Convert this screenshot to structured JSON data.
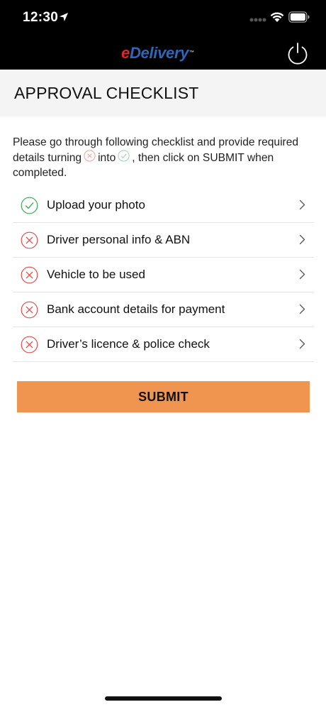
{
  "status_bar": {
    "time": "12:30",
    "icons": [
      "location-arrow-icon",
      "cellular-signal-icon",
      "wifi-icon",
      "battery-icon"
    ]
  },
  "header": {
    "logo_prefix": "e",
    "logo_text": "Delivery",
    "logo_tm": "™",
    "power_icon": "power-icon"
  },
  "page": {
    "title": "APPROVAL CHECKLIST"
  },
  "instructions": {
    "part1": "Please go through following checklist and provide required details turning",
    "part2": "into",
    "part3": ", then click on SUBMIT when completed."
  },
  "checklist": {
    "items": [
      {
        "label": "Upload your photo",
        "status": "complete"
      },
      {
        "label": "Driver personal info & ABN",
        "status": "incomplete"
      },
      {
        "label": "Vehicle to be used",
        "status": "incomplete"
      },
      {
        "label": "Bank account details for payment",
        "status": "incomplete"
      },
      {
        "label": "Driver’s licence & police check",
        "status": "incomplete"
      }
    ]
  },
  "actions": {
    "submit_label": "SUBMIT"
  },
  "colors": {
    "header_bg": "#000000",
    "title_band_bg": "#f5f4f5",
    "complete_green": "#3aa655",
    "incomplete_red": "#e04a4a",
    "submit_orange": "#f0954f",
    "logo_blue": "#2f66b8",
    "logo_red": "#e0262b"
  }
}
